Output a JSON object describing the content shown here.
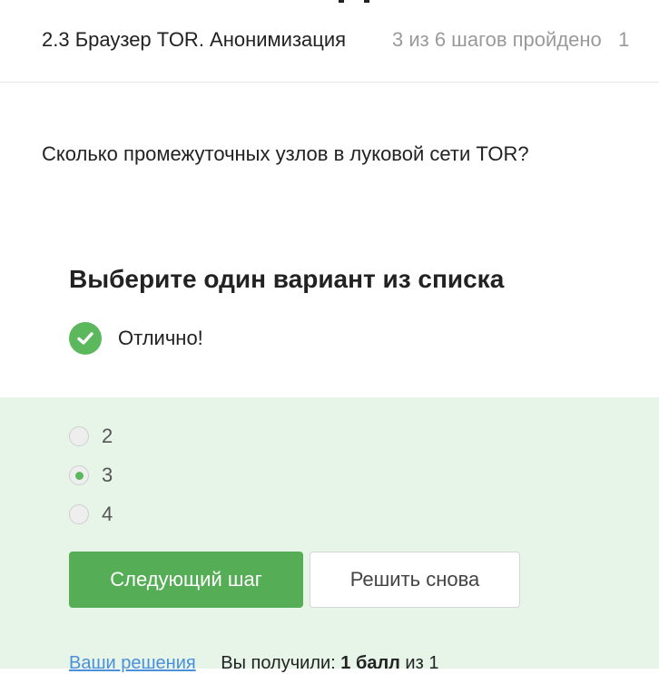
{
  "header": {
    "lesson_title": "2.3 Браузер TOR. Анонимизация",
    "progress": "3 из 6 шагов пройдено",
    "overflow_text": "1"
  },
  "step": {
    "question": "Сколько промежуточных узлов в луковой сети TOR?",
    "section_title": "Выберите один вариант из списка",
    "feedback": "Отлично!",
    "feedback_icon": "check-circle-icon"
  },
  "options": [
    {
      "label": "2",
      "selected": false
    },
    {
      "label": "3",
      "selected": true
    },
    {
      "label": "4",
      "selected": false
    }
  ],
  "buttons": {
    "next_label": "Следующий шаг",
    "retry_label": "Решить снова"
  },
  "footer": {
    "solutions_link": "Ваши решения",
    "score_label": "Вы получили:",
    "score_value": "1 балл",
    "score_total": "из 1"
  },
  "colors": {
    "accent_green": "#55ad55",
    "panel_background": "#e7f5e9",
    "link_blue": "#4a90d9"
  }
}
